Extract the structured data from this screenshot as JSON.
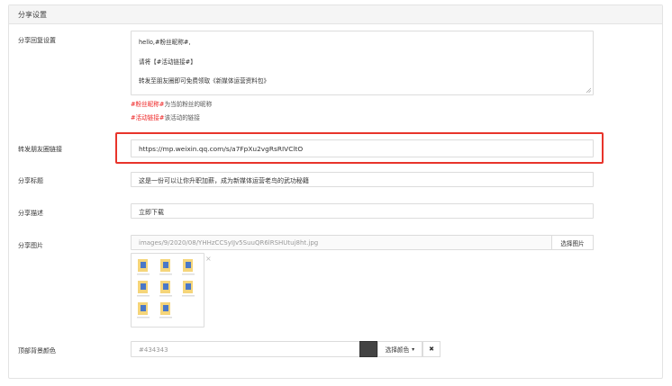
{
  "panel": {
    "title": "分享设置"
  },
  "share_reply": {
    "label": "分享回复设置",
    "lines": [
      "hello,#粉丝昵称#,",
      "请将【#活动链接#】",
      "转发至朋友圈即可免费领取《新媒体运营资料包》"
    ],
    "hint1_red": "#粉丝昵称#",
    "hint1_rest": "为当前粉丝的昵称",
    "hint2_red": "#活动链接#",
    "hint2_rest": "该活动的链接"
  },
  "moments_link": {
    "label": "转发朋友圈链接",
    "value": "https://mp.weixin.qq.com/s/a7FpXu2vgRsRIVCltO"
  },
  "share_title": {
    "label": "分享标题",
    "value": "这是一份可以让你升职加薪，成为新媒体运营老鸟的武功秘籍"
  },
  "share_desc": {
    "label": "分享描述",
    "value": "立即下载"
  },
  "share_image": {
    "label": "分享图片",
    "path": "images/9/2020/08/YHHzCCSyIJv5SuuQR6lRSHUtuj8ht.jpg",
    "select_button": "选择图片",
    "close_glyph": "×"
  },
  "header_bg": {
    "label": "顶部背景颜色",
    "value": "#434343",
    "swatch_color": "#434343",
    "pick_button": "选择颜色",
    "caret": "▾",
    "clear_glyph": "✖"
  },
  "colors": {
    "highlight_border": "#e8342b",
    "hint_red": "#e22"
  }
}
